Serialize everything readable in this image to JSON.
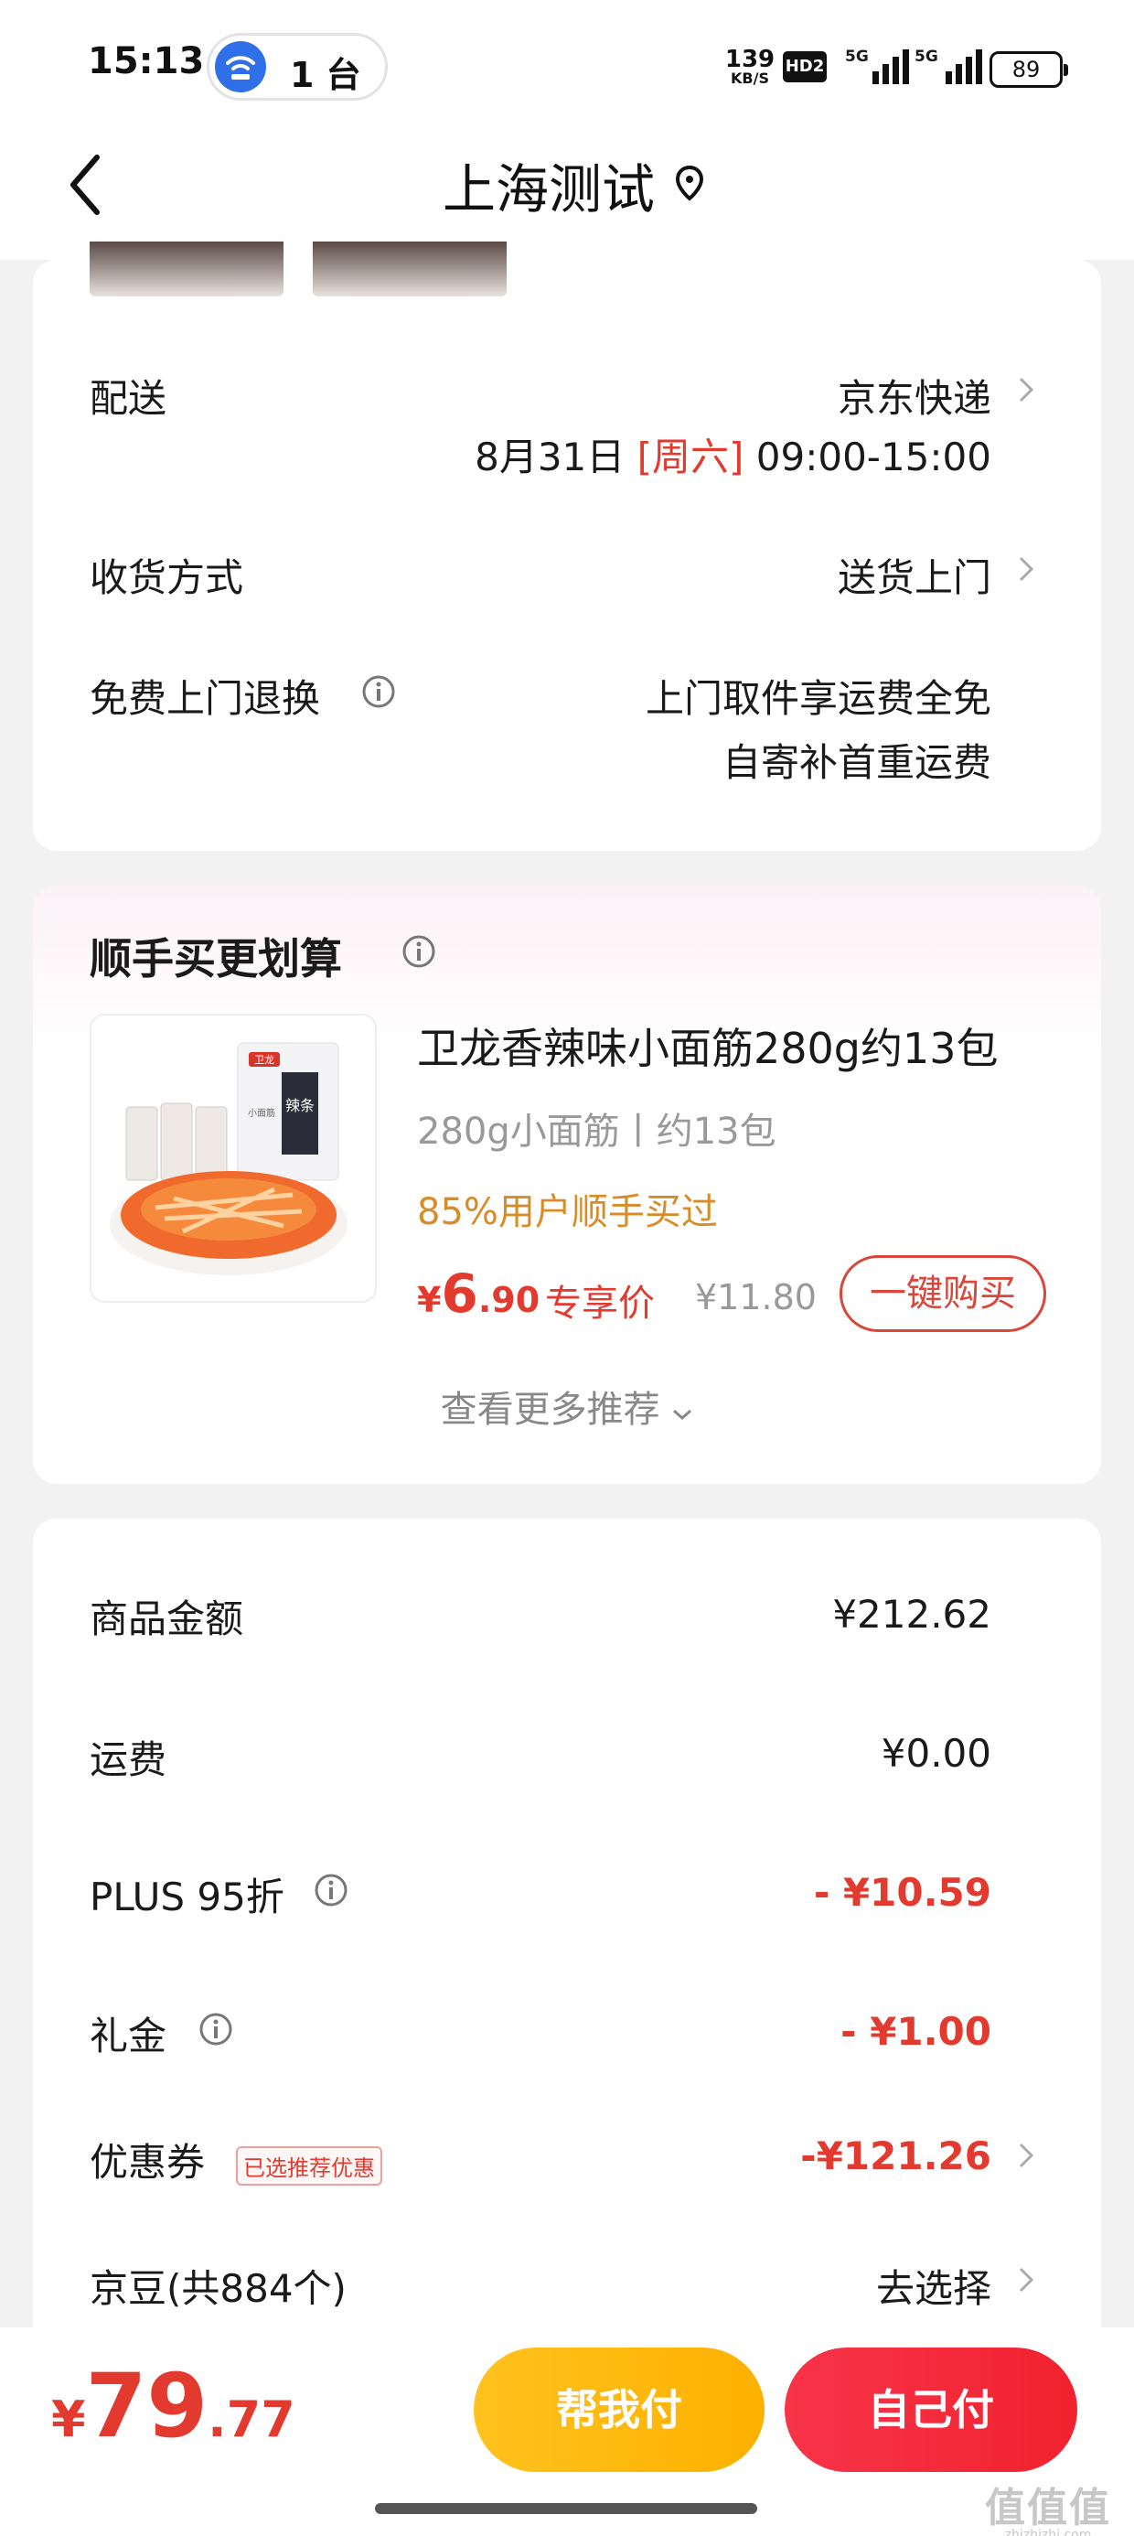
{
  "status_bar": {
    "time": "15:13",
    "hotspot_count": "1 台",
    "net_speed": "139",
    "net_unit": "KB/S",
    "hd_badge": "HD2",
    "sig1_tag": "5G",
    "sig2_tag": "5G",
    "battery": "89"
  },
  "header": {
    "title": "上海测试"
  },
  "delivery": {
    "shipping_label": "配送",
    "shipping_value": "京东快递",
    "date": "8月31日",
    "weekday": "[周六]",
    "time_window": "09:00-15:00",
    "receive_label": "收货方式",
    "receive_value": "送货上门",
    "return_label": "免费上门退换",
    "return_line1": "上门取件享运费全免",
    "return_line2": "自寄补首重运费"
  },
  "recommend": {
    "title": "顺手买更划算",
    "product_name": "卫龙香辣味小面筋280g约13包",
    "product_spec": "280g小面筋丨约13包",
    "product_stat": "85%用户顺手买过",
    "price_symbol": "¥",
    "price_int": "6",
    "price_dec": ".90",
    "price_tag": "专享价",
    "original_price": "¥11.80",
    "buy_button": "一键购买",
    "more_label": "查看更多推荐",
    "package_brand": "卫龙",
    "package_text": "辣条",
    "package_small": "小面筋"
  },
  "totals": {
    "goods_label": "商品金额",
    "goods_value": "¥212.62",
    "freight_label": "运费",
    "freight_value": "¥0.00",
    "plus_label": "PLUS 95折",
    "plus_value": "- ¥10.59",
    "gift_label": "礼金",
    "gift_value": "- ¥1.00",
    "coupon_label": "优惠券",
    "coupon_badge": "已选推荐优惠",
    "coupon_value": "-¥121.26",
    "beans_label": "京豆(共884个)",
    "beans_value": "去选择"
  },
  "bottom_bar": {
    "currency": "¥",
    "total_int": "79",
    "total_dec": ".77",
    "help_pay": "帮我付",
    "self_pay": "自己付"
  },
  "watermark": {
    "mark": "值值值",
    "url": "zhizhizhi.com"
  },
  "colors": {
    "price_red": "#e23a2e",
    "stat_orange": "#d88c28",
    "help_button": "#ffc21e",
    "self_button": "#f0222e"
  }
}
